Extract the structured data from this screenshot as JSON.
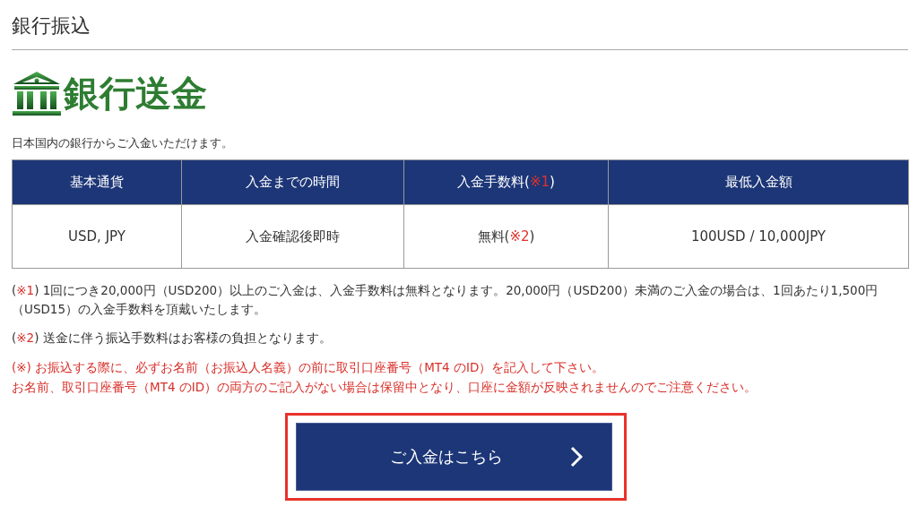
{
  "heading": "銀行振込",
  "logo": {
    "text": "銀行送金"
  },
  "intro": "日本国内の銀行からご入金いただけます。",
  "table": {
    "columns": [
      {
        "parts": [
          {
            "text": "基本通貨",
            "kind": "plain"
          }
        ]
      },
      {
        "parts": [
          {
            "text": "入金までの時間",
            "kind": "plain"
          }
        ]
      },
      {
        "parts": [
          {
            "text": "入金手数料(",
            "kind": "plain"
          },
          {
            "text": "※1",
            "kind": "red"
          },
          {
            "text": ")",
            "kind": "plain"
          }
        ]
      },
      {
        "parts": [
          {
            "text": "最低入金額",
            "kind": "plain"
          }
        ]
      }
    ],
    "rows": [
      {
        "cells": [
          {
            "parts": [
              {
                "text": "USD, JPY",
                "kind": "plain"
              }
            ]
          },
          {
            "parts": [
              {
                "text": "入金確認後即時",
                "kind": "plain"
              }
            ]
          },
          {
            "parts": [
              {
                "text": "無料(",
                "kind": "plain"
              },
              {
                "text": "※2",
                "kind": "red"
              },
              {
                "text": ")",
                "kind": "plain"
              }
            ]
          },
          {
            "parts": [
              {
                "text": "100USD / 10,000JPY",
                "kind": "plain"
              }
            ]
          }
        ]
      }
    ]
  },
  "notes": [
    {
      "kind": "plain",
      "lines": [
        [
          {
            "text": "(",
            "kind": "plain"
          },
          {
            "text": "※1",
            "kind": "red"
          },
          {
            "text": ") 1回につき20,000円（USD200）以上のご入金は、入金手数料は無料となります。20,000円（USD200）未満のご入金の場合は、1回あたり1,500円（USD15）の入金手数料を頂戴いたします。",
            "kind": "plain"
          }
        ]
      ]
    },
    {
      "kind": "plain",
      "lines": [
        [
          {
            "text": "(",
            "kind": "plain"
          },
          {
            "text": "※2",
            "kind": "red"
          },
          {
            "text": ") 送金に伴う振込手数料はお客様の負担となります。",
            "kind": "plain"
          }
        ]
      ]
    },
    {
      "kind": "red",
      "lines": [
        [
          {
            "text": "(※) お振込する際に、必ずお名前（お振込人名義）の前に取引口座番号（MT4 のID）を記入して下さい。",
            "kind": "red"
          }
        ],
        [
          {
            "text": "お名前、取引口座番号（MT4 のID）の両方のご記入がない場合は保留中となり、口座に金額が反映されませんのでご注意ください。",
            "kind": "red"
          }
        ]
      ]
    }
  ],
  "button": {
    "label": "ご入金はこちら",
    "highlighted": true
  }
}
